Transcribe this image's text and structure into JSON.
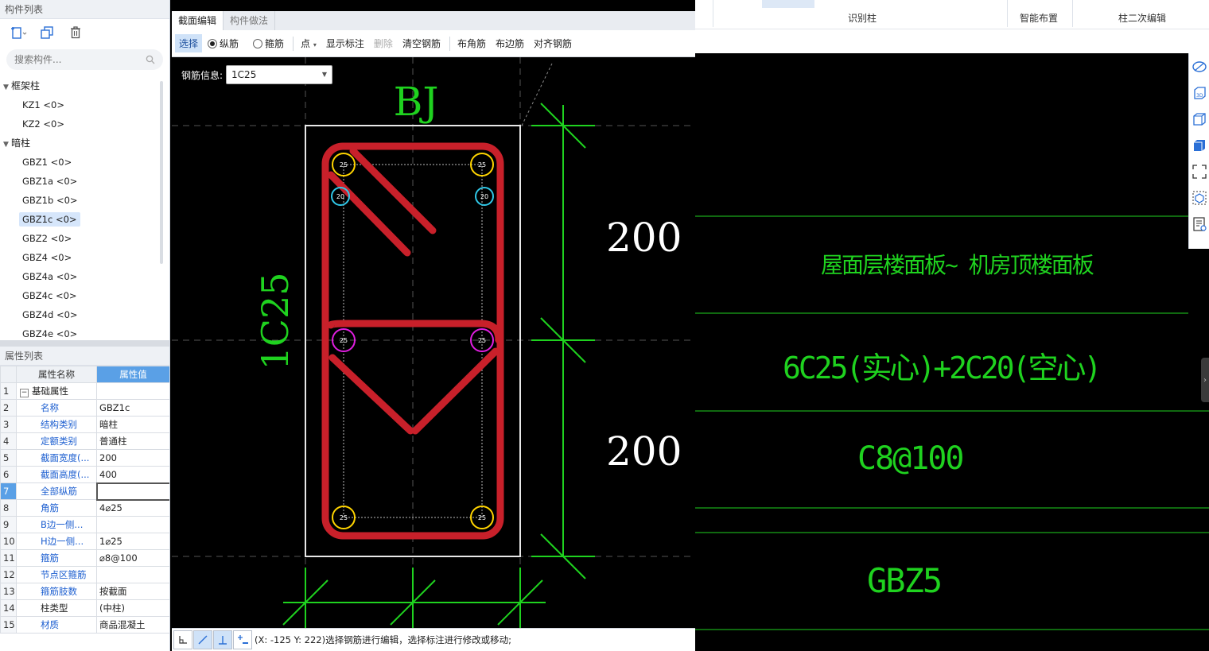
{
  "left": {
    "component_list_title": "构件列表",
    "search_placeholder": "搜索构件...",
    "groups": [
      {
        "label": "框架柱",
        "items": [
          "KZ1 <0>",
          "KZ2 <0>"
        ]
      },
      {
        "label": "暗柱",
        "items": [
          "GBZ1 <0>",
          "GBZ1a <0>",
          "GBZ1b <0>",
          "GBZ1c <0>",
          "GBZ2 <0>",
          "GBZ4 <0>",
          "GBZ4a <0>",
          "GBZ4c <0>",
          "GBZ4d <0>",
          "GBZ4e <0>"
        ]
      }
    ],
    "selected_item": "GBZ1c <0>",
    "property_list_title": "属性列表",
    "prop_headers": {
      "name": "属性名称",
      "value": "属性值"
    },
    "props": [
      {
        "no": "1",
        "name": "基础属性",
        "value": ""
      },
      {
        "no": "2",
        "name": "名称",
        "value": "GBZ1c"
      },
      {
        "no": "3",
        "name": "结构类别",
        "value": "暗柱"
      },
      {
        "no": "4",
        "name": "定额类别",
        "value": "普通柱"
      },
      {
        "no": "5",
        "name": "截面宽度(...",
        "value": "200"
      },
      {
        "no": "6",
        "name": "截面高度(...",
        "value": "400"
      },
      {
        "no": "7",
        "name": "全部纵筋",
        "value": ""
      },
      {
        "no": "8",
        "name": "角筋",
        "value": "4⌀25"
      },
      {
        "no": "9",
        "name": "B边一侧...",
        "value": ""
      },
      {
        "no": "10",
        "name": "H边一侧...",
        "value": "1⌀25"
      },
      {
        "no": "11",
        "name": "箍筋",
        "value": "⌀8@100"
      },
      {
        "no": "12",
        "name": "节点区箍筋",
        "value": ""
      },
      {
        "no": "13",
        "name": "箍筋肢数",
        "value": "按截面"
      },
      {
        "no": "14",
        "name": "柱类型",
        "value": "(中柱)"
      },
      {
        "no": "15",
        "name": "材质",
        "value": "商品混凝土"
      }
    ]
  },
  "mid": {
    "tabs": [
      "截面编辑",
      "构件做法"
    ],
    "toolbar": {
      "select": "选择",
      "longitudinal": "纵筋",
      "stirrup": "箍筋",
      "point": "点",
      "show_label": "显示标注",
      "delete": "删除",
      "clear_rebar": "清空钢筋",
      "corner_rebar": "布角筋",
      "edge_rebar": "布边筋",
      "align_rebar": "对齐钢筋"
    },
    "rebar_info_label": "钢筋信息:",
    "rebar_info_value": "1C25",
    "drawing": {
      "title": "BJ",
      "side_label": "1C25",
      "dim_top": "200",
      "dim_bottom": "200",
      "bar_labels": [
        "25",
        "25",
        "20",
        "20",
        "25",
        "25",
        "25",
        "25"
      ]
    },
    "status_text": "(X: -125 Y: 222)选择钢筋进行编辑，选择标注进行修改或移动;"
  },
  "right": {
    "ribbon": {
      "recognize_column": "识别柱",
      "smart_layout": "智能布置",
      "secondary_edit": "柱二次编辑"
    },
    "cad": {
      "line1": "屋面层楼面板~ 机房顶楼面板",
      "line2": "6C25(实心)+2C20(空心)",
      "line3": "C8@100",
      "line4": "GBZ5"
    }
  },
  "colors": {
    "cad_green": "#1fd21f",
    "stirrup_red": "#c8202a",
    "corner_bar_yellow": "#ffd400",
    "edge_bar_magenta": "#e01ee0",
    "small_bar_cyan": "#30c8e8",
    "accent_blue": "#5aa0e6"
  }
}
